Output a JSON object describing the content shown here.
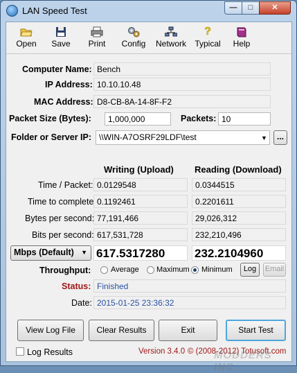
{
  "window": {
    "title": "LAN Speed Test"
  },
  "toolbar": [
    {
      "label": "Open",
      "icon": "folder-open-icon"
    },
    {
      "label": "Save",
      "icon": "floppy-disk-icon"
    },
    {
      "label": "Print",
      "icon": "printer-icon"
    },
    {
      "label": "Config",
      "icon": "gears-icon"
    },
    {
      "label": "Network",
      "icon": "network-icon"
    },
    {
      "label": "Typical",
      "icon": "question-icon"
    },
    {
      "label": "Help",
      "icon": "book-icon"
    }
  ],
  "info": {
    "computer_name_label": "Computer Name:",
    "computer_name": "Bench",
    "ip_label": "IP Address:",
    "ip": "10.10.10.48",
    "mac_label": "MAC Address:",
    "mac": "D8-CB-8A-14-8F-F2",
    "packet_size_label": "Packet Size (Bytes):",
    "packet_size": "1,000,000",
    "packets_label": "Packets:",
    "packets": "10",
    "folder_label": "Folder or Server IP:",
    "folder": "\\\\WIN-A7OSRF29LDF\\test",
    "browse_label": "..."
  },
  "results": {
    "writing_header": "Writing (Upload)",
    "reading_header": "Reading (Download)",
    "rows": [
      {
        "label": "Time / Packet:",
        "write": "0.0129548",
        "read": "0.0344515"
      },
      {
        "label": "Time to complete:",
        "write": "0.1192461",
        "read": "0.2201611"
      },
      {
        "label": "Bytes per second:",
        "write": "77,191,466",
        "read": "29,026,312"
      },
      {
        "label": "Bits per second:",
        "write": "617,531,728",
        "read": "232,210,496"
      }
    ],
    "unit_select": "Mbps (Default)",
    "mbps_write": "617.5317280",
    "mbps_read": "232.2104960"
  },
  "throughput": {
    "label": "Throughput:",
    "average": "Average",
    "maximum": "Maximum",
    "minimum": "Minimum",
    "selected": "Minimum",
    "log_button": "Log",
    "email_button": "Email"
  },
  "status": {
    "status_label": "Status:",
    "status_value": "Finished",
    "date_label": "Date:",
    "date_value": "2015-01-25 23:36:32"
  },
  "buttons": {
    "view_log": "View Log File",
    "clear": "Clear Results",
    "exit": "Exit",
    "start": "Start Test"
  },
  "footer": {
    "log_results": "Log Results",
    "version": "Version 3.4.0",
    "copyright": "© (2008-2012) Totusoft.com"
  },
  "watermark": "MODDERS INC",
  "colors": {
    "status_label": "#a01818",
    "status_value": "#2952a3",
    "version_text": "#a01818"
  }
}
